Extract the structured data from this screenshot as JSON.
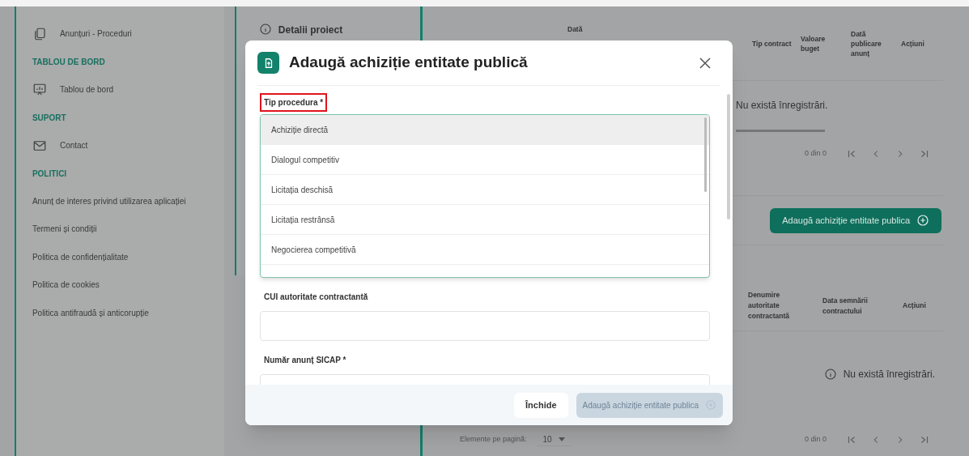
{
  "sidebar": {
    "items": [
      {
        "kind": "link",
        "label": "Anunțuri - Proceduri"
      },
      {
        "kind": "section",
        "label": "TABLOU DE BORD"
      },
      {
        "kind": "link",
        "label": "Tablou de bord"
      },
      {
        "kind": "section",
        "label": "SUPORT"
      },
      {
        "kind": "link",
        "label": "Contact"
      },
      {
        "kind": "section",
        "label": "POLITICI"
      },
      {
        "kind": "plain",
        "label": "Anunț de interes privind utilizarea aplicației"
      },
      {
        "kind": "plain",
        "label": "Termeni și condiții"
      },
      {
        "kind": "plain",
        "label": "Politica de confidențialitate"
      },
      {
        "kind": "plain",
        "label": "Politica de cookies"
      },
      {
        "kind": "plain",
        "label": "Politica antifraudă și anticorupție"
      }
    ]
  },
  "project_panel": {
    "title": "Detalii proiect"
  },
  "table_1": {
    "columns": [
      "Dată",
      "Tip contract",
      "Valoare buget",
      "Dată publicare anunț",
      "Acțiuni"
    ],
    "empty_message": "Nu există înregistrări.",
    "pagination": {
      "range": "0 din 0"
    }
  },
  "add_button": "Adaugă achiziție entitate publica",
  "table_2": {
    "columns": [
      "Denumire autoritate contractantă",
      "Data semnării contractului",
      "Acțiuni"
    ],
    "empty_message": "Nu există înregistrări.",
    "pagination": {
      "range": "0 din 0",
      "page_size_label": "Elemente pe pagină:",
      "page_size": "10"
    }
  },
  "dialog": {
    "title": "Adaugă achiziție entitate publică",
    "fields": [
      {
        "kind": "select",
        "label": "Tip procedura *",
        "highlighted": true,
        "expanded": true,
        "options": [
          {
            "label": "Achiziție directă",
            "selected": true
          },
          {
            "label": "Dialogul competitiv",
            "selected": false
          },
          {
            "label": "Licitația deschisă",
            "selected": false
          },
          {
            "label": "Licitația restrânsă",
            "selected": false
          },
          {
            "label": "Negocierea competitivă",
            "selected": false
          }
        ]
      },
      {
        "kind": "text",
        "label": "CUI autoritate contractantă",
        "highlighted": false
      },
      {
        "kind": "text",
        "label": "Număr anunț SICAP *",
        "highlighted": false
      }
    ],
    "buttons": [
      {
        "label": "Închide",
        "disabled": false
      },
      {
        "label": "Adaugă achiziție entitate publica",
        "disabled": true
      }
    ]
  }
}
